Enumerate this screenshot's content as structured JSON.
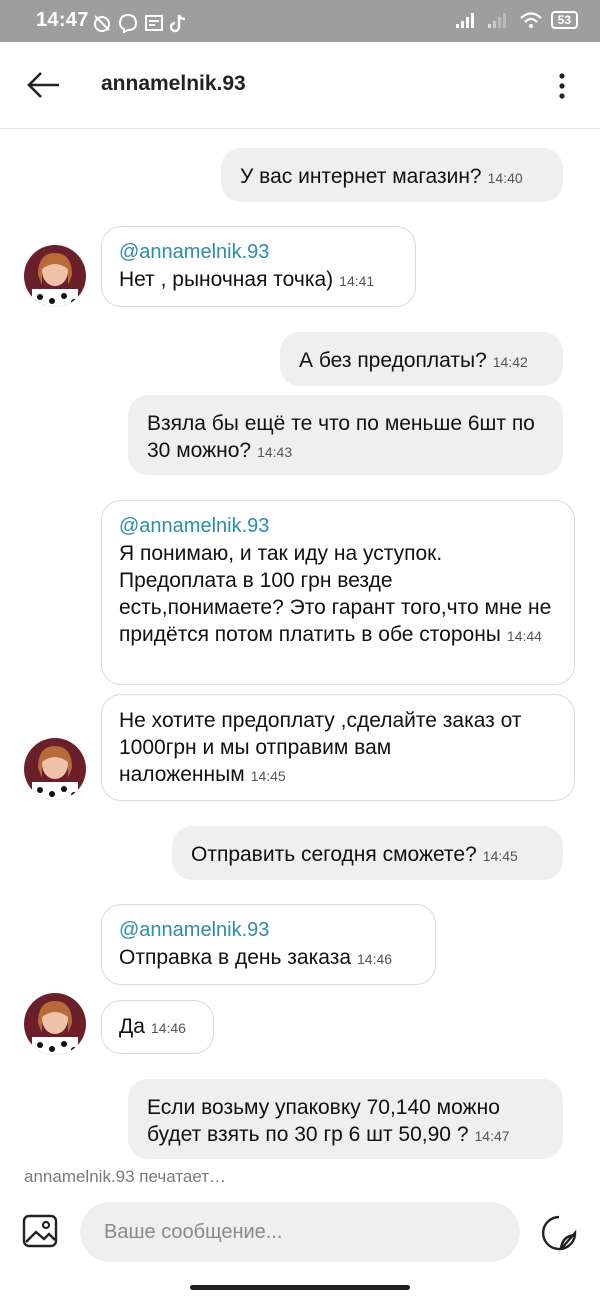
{
  "status_bar": {
    "time": "14:47",
    "battery": "53"
  },
  "header": {
    "title": "annamelnik.93"
  },
  "messages": [
    {
      "text": "У вас интернет магазин?",
      "time": "14:40"
    },
    {
      "mention": "@annamelnik.93",
      "text": "Нет , рыночная точка)",
      "time": "14:41"
    },
    {
      "text": "А без предоплаты?",
      "time": "14:42"
    },
    {
      "text": "Взяла бы ещё те что по меньше 6шт по 30 можно?",
      "time": "14:43"
    },
    {
      "mention": "@annamelnik.93",
      "text": "Я понимаю, и так иду на уступок. Предоплата в 100 грн везде есть,понимаете? Это гарант того,что мне не придётся потом платить в обе стороны",
      "time": "14:44"
    },
    {
      "text": "Не хотите предоплату ,сделайте заказ от 1000грн и мы отправим вам наложенным",
      "time": "14:45"
    },
    {
      "text": "Отправить сегодня сможете?",
      "time": "14:45"
    },
    {
      "mention": "@annamelnik.93",
      "text": "Отправка в день заказа",
      "time": "14:46"
    },
    {
      "text": "Да",
      "time": "14:46"
    },
    {
      "text": "Если возьму упаковку 70,140  можно будет взять по 30 гр 6 шт 50,90 ?",
      "time": "14:47"
    }
  ],
  "typing_indicator": "annamelnik.93 печатает…",
  "composer": {
    "placeholder": "Ваше сообщение..."
  },
  "icons": [
    "back-arrow-icon",
    "more-vertical-icon",
    "image-icon",
    "sticker-icon"
  ]
}
